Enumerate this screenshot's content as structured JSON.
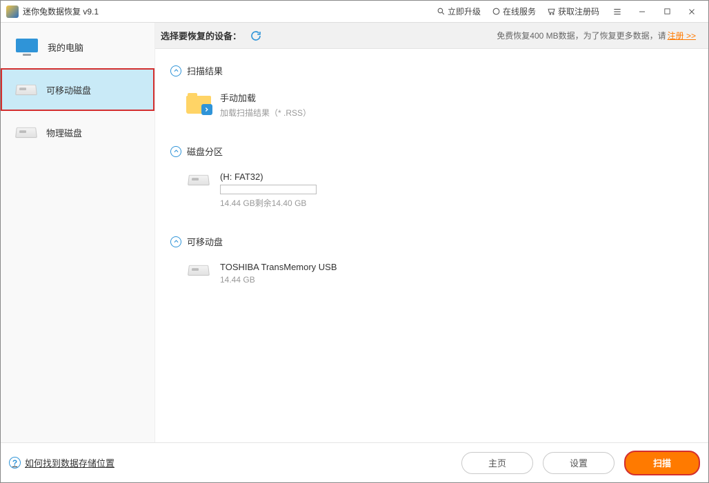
{
  "titlebar": {
    "app_title": "迷你兔数据恢复 v9.1",
    "upgrade": "立即升级",
    "online_service": "在线服务",
    "get_reg": "获取注册码"
  },
  "sidebar": {
    "items": [
      {
        "label": "我的电脑"
      },
      {
        "label": "可移动磁盘"
      },
      {
        "label": "物理磁盘"
      }
    ]
  },
  "topstrip": {
    "label": "选择要恢复的设备：",
    "promo_prefix": "免费恢复400 MB数据，为了恢复更多数据，请",
    "promo_link": "注册 >>"
  },
  "sections": {
    "scan_result": {
      "title": "扫描结果",
      "manual": {
        "l1": "手动加载",
        "l2": "加载扫描结果（* .RSS）"
      }
    },
    "partitions": {
      "title": "磁盘分区",
      "part0": {
        "l1": "(H: FAT32)",
        "l2": "14.44 GB剩余14.40 GB"
      }
    },
    "removable": {
      "title": "可移动盘",
      "disk0": {
        "l1": "TOSHIBA TransMemory USB",
        "l2": "14.44 GB"
      }
    }
  },
  "footer": {
    "help": "如何找到数据存储位置",
    "home": "主页",
    "settings": "设置",
    "scan": "扫描"
  }
}
